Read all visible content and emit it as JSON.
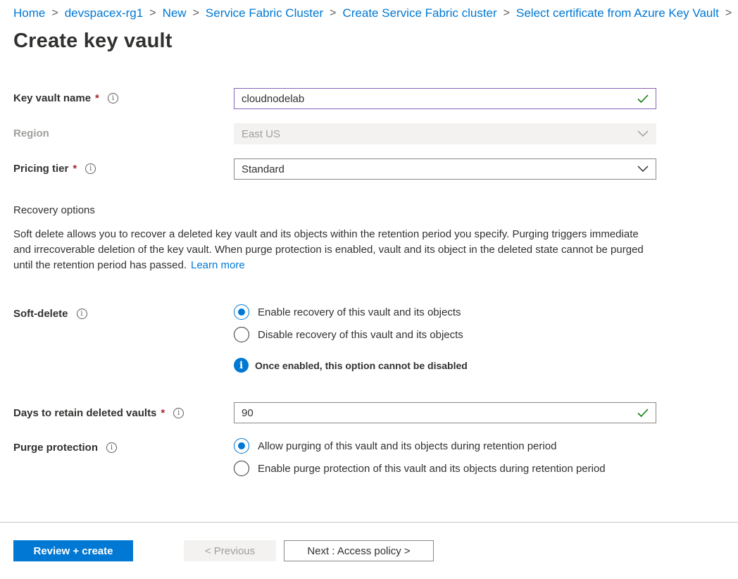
{
  "breadcrumb": [
    "Home",
    "devspacex-rg1",
    "New",
    "Service Fabric Cluster",
    "Create Service Fabric cluster",
    "Select certificate from Azure Key Vault"
  ],
  "page_title": "Create key vault",
  "fields": {
    "key_vault_name": {
      "label": "Key vault name",
      "required": "*",
      "value": "cloudnodelab"
    },
    "region": {
      "label": "Region",
      "value": "East US"
    },
    "pricing_tier": {
      "label": "Pricing tier",
      "required": "*",
      "value": "Standard"
    }
  },
  "recovery": {
    "heading": "Recovery options",
    "description": "Soft delete allows you to recover a deleted key vault and its objects within the retention period you specify. Purging triggers immediate and irrecoverable deletion of the key vault. When purge protection is enabled, vault and its object in the deleted state cannot be purged until the retention period has passed.",
    "learn_more": "Learn more"
  },
  "soft_delete": {
    "label": "Soft-delete",
    "options": [
      "Enable recovery of this vault and its objects",
      "Disable recovery of this vault and its objects"
    ],
    "selected": 0,
    "info": "Once enabled, this option cannot be disabled"
  },
  "days_retain": {
    "label": "Days to retain deleted vaults",
    "required": "*",
    "value": "90"
  },
  "purge_protection": {
    "label": "Purge protection",
    "options": [
      "Allow purging of this vault and its objects during retention period",
      "Enable purge protection of this vault and its objects during retention period"
    ],
    "selected": 0
  },
  "footer": {
    "review_create": "Review + create",
    "previous": "< Previous",
    "next": "Next : Access policy >"
  },
  "colors": {
    "accent": "#0078d4",
    "required": "#a4262c",
    "valid": "#107c10",
    "focus": "#8764b8"
  }
}
